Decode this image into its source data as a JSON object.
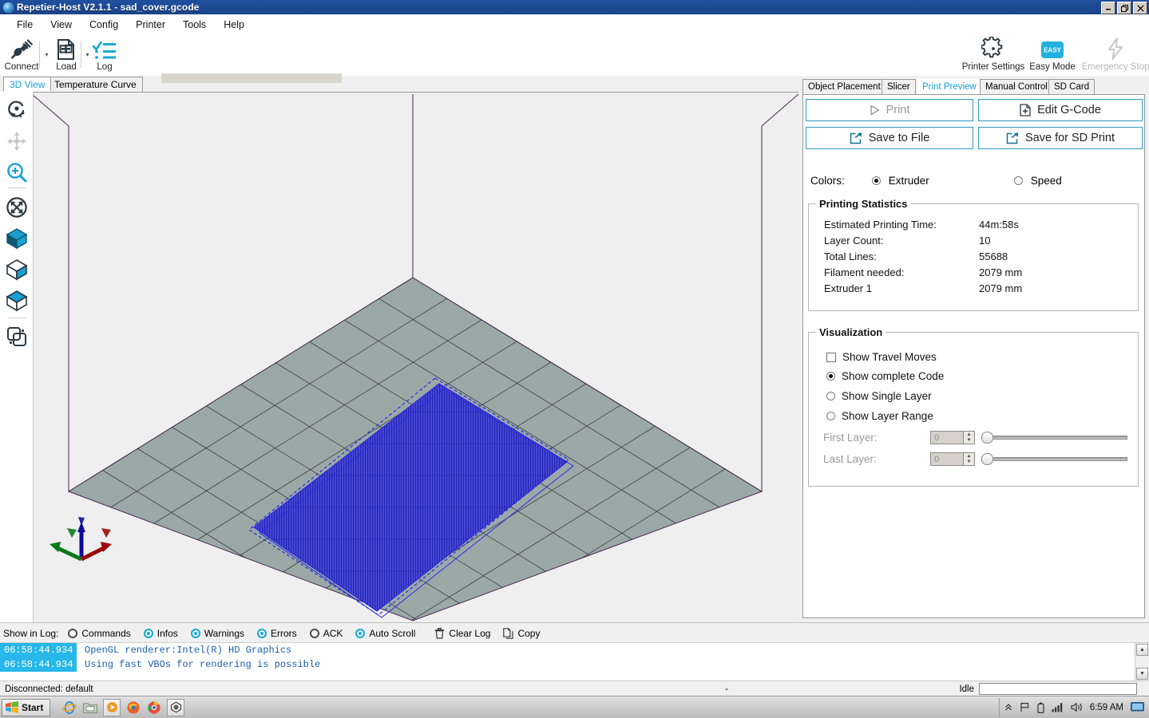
{
  "window": {
    "title": "Repetier-Host V2.1.1 - sad_cover.gcode",
    "minimize": "_",
    "restore": "❐",
    "close": "✕"
  },
  "menu": {
    "items": [
      "File",
      "View",
      "Config",
      "Printer",
      "Tools",
      "Help"
    ]
  },
  "toolbar": {
    "left": [
      {
        "label": "Connect",
        "icon": "plug-icon",
        "disabled": false
      },
      {
        "label": "Load",
        "icon": "load-file-icon",
        "disabled": false
      },
      {
        "label": "Log",
        "icon": "log-list-icon",
        "disabled": false
      }
    ],
    "right": [
      {
        "label": "Printer Settings",
        "icon": "gear-icon",
        "disabled": false
      },
      {
        "label": "Easy Mode",
        "icon": "easy-badge-icon",
        "badge": "EASY",
        "disabled": false
      },
      {
        "label": "Emergency Stop",
        "icon": "lightning-icon",
        "disabled": true
      }
    ]
  },
  "left_panel": {
    "tabs": [
      {
        "label": "3D View",
        "active": true
      },
      {
        "label": "Temperature Curve",
        "active": false
      }
    ],
    "tools": [
      "rotate-view-icon",
      "move-view-icon",
      "zoom-view-icon",
      "scale-view-icon",
      "perspective-view-icon",
      "front-view-icon",
      "top-view-icon",
      "object-overlap-icon"
    ],
    "axis_indicator": {
      "x": "X",
      "y": "Y",
      "z": "Z"
    }
  },
  "right_panel": {
    "tabs": [
      {
        "label": "Object Placement",
        "active": false
      },
      {
        "label": "Slicer",
        "active": false
      },
      {
        "label": "Print Preview",
        "active": true
      },
      {
        "label": "Manual Control",
        "active": false
      },
      {
        "label": "SD Card",
        "active": false
      }
    ],
    "buttons": [
      {
        "label": "Print",
        "icon": "play-icon",
        "disabled": true
      },
      {
        "label": "Edit G-Code",
        "icon": "edit-file-icon",
        "disabled": false
      },
      {
        "label": "Save to File",
        "icon": "export-icon",
        "disabled": false
      },
      {
        "label": "Save for SD Print",
        "icon": "export-icon",
        "disabled": false
      }
    ],
    "colors": {
      "label": "Colors:",
      "options": [
        {
          "label": "Extruder",
          "selected": true
        },
        {
          "label": "Speed",
          "selected": false
        }
      ]
    },
    "printing_statistics": {
      "title": "Printing Statistics",
      "rows": [
        {
          "label": "Estimated Printing Time:",
          "value": "44m:58s"
        },
        {
          "label": "Layer Count:",
          "value": "10"
        },
        {
          "label": "Total Lines:",
          "value": "55688"
        },
        {
          "label": "Filament needed:",
          "value": "2079 mm"
        },
        {
          "label": "Extruder 1",
          "value": "2079 mm"
        }
      ]
    },
    "visualization": {
      "title": "Visualization",
      "show_travel_moves": {
        "label": "Show Travel Moves",
        "checked": false
      },
      "modes": [
        {
          "label": "Show complete Code",
          "selected": true
        },
        {
          "label": "Show Single Layer",
          "selected": false
        },
        {
          "label": "Show Layer Range",
          "selected": false
        }
      ],
      "first_layer": {
        "label": "First Layer:",
        "value": "0",
        "disabled": true
      },
      "last_layer": {
        "label": "Last Layer:",
        "value": "0",
        "disabled": true
      }
    }
  },
  "log": {
    "show_in_log_label": "Show in Log:",
    "filters": [
      {
        "label": "Commands",
        "on": false
      },
      {
        "label": "Infos",
        "on": true
      },
      {
        "label": "Warnings",
        "on": true
      },
      {
        "label": "Errors",
        "on": true
      },
      {
        "label": "ACK",
        "on": false
      },
      {
        "label": "Auto Scroll",
        "on": true
      }
    ],
    "actions": [
      {
        "label": "Clear Log",
        "icon": "trash-icon"
      },
      {
        "label": "Copy",
        "icon": "copy-icon"
      }
    ],
    "lines": [
      {
        "time": "06:58:44.934",
        "message": "OpenGL renderer:Intel(R) HD Graphics"
      },
      {
        "time": "06:58:44.934",
        "message": "Using fast VBOs for rendering is possible"
      }
    ]
  },
  "status_bar": {
    "connection": "Disconnected: default",
    "middle": "-",
    "state": "Idle",
    "input_value": ""
  },
  "taskbar": {
    "start": "Start",
    "quick_launch": [
      "internet-explorer-icon",
      "folder-icon",
      "media-player-icon",
      "firefox-icon",
      "chrome-icon",
      "repetier-host-icon"
    ],
    "tray": [
      "chevron-up-icon",
      "flag-icon",
      "battery-icon",
      "signal-icon",
      "speaker-icon"
    ],
    "clock": "6:59 AM",
    "show_desktop": "show-desktop-icon"
  },
  "colors": {
    "accent": "#1b9fd8",
    "title_bar": "#1f4f9e",
    "button_border": "#2e9bc4",
    "bed": "#9aa9a6",
    "print": "#3b3bd8",
    "log_time_bg": "#27b7e8",
    "log_text": "#1b5fa8"
  }
}
